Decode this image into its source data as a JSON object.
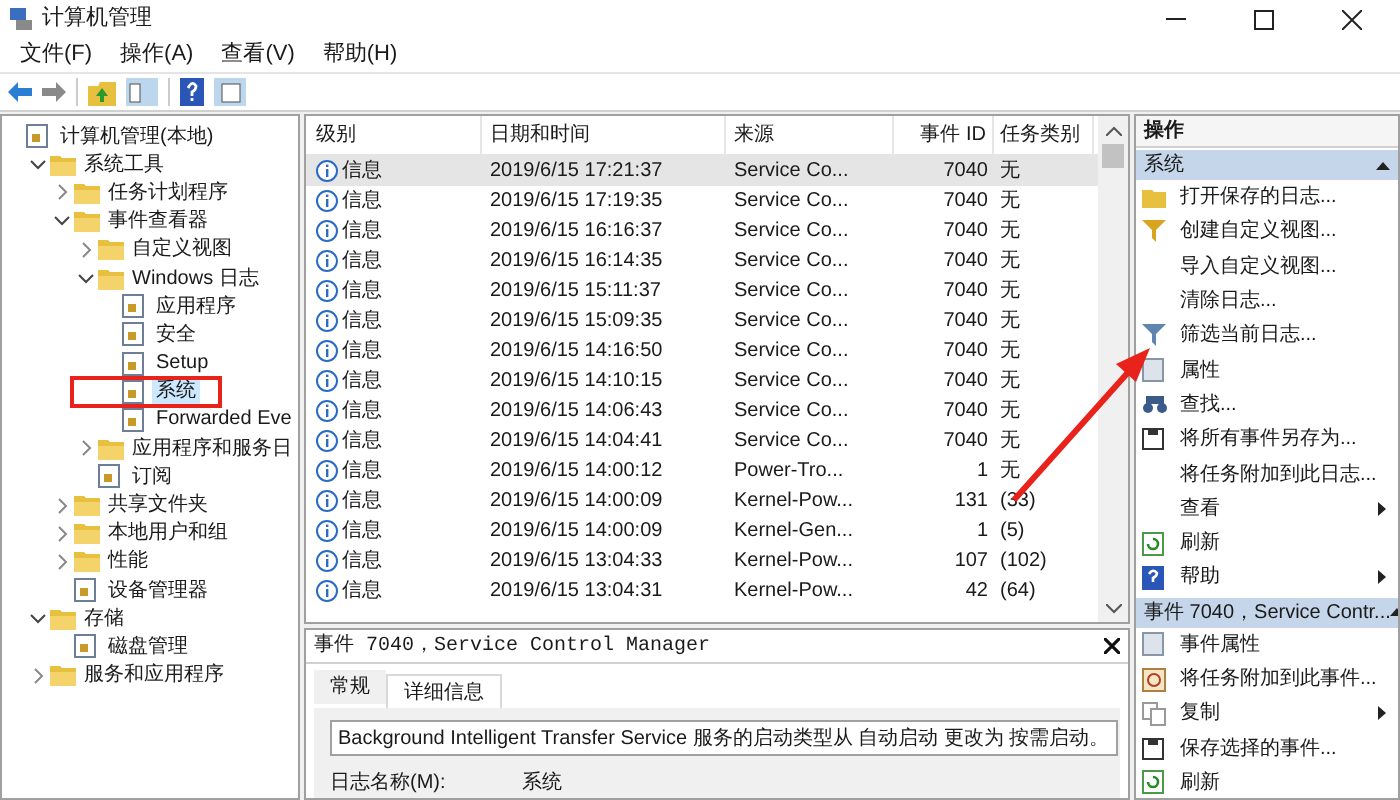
{
  "window": {
    "title": "计算机管理"
  },
  "menu": [
    "文件(F)",
    "操作(A)",
    "查看(V)",
    "帮助(H)"
  ],
  "tree": [
    {
      "label": "计算机管理(本地)",
      "kind": "plain",
      "selected": false,
      "marked": false,
      "children": [
        {
          "label": "系统工具",
          "kind": "toggle",
          "expanded": true,
          "selected": false,
          "marked": false,
          "children": [
            {
              "label": "任务计划程序",
              "kind": "toggle",
              "expanded": false,
              "selected": false,
              "marked": false
            },
            {
              "label": "事件查看器",
              "kind": "toggle",
              "expanded": true,
              "selected": false,
              "marked": false,
              "children": [
                {
                  "label": "自定义视图",
                  "kind": "toggle",
                  "expanded": false,
                  "selected": false,
                  "marked": false
                },
                {
                  "label": "Windows 日志",
                  "kind": "toggle",
                  "expanded": true,
                  "selected": false,
                  "marked": false,
                  "children": [
                    {
                      "label": "应用程序",
                      "kind": "plain",
                      "selected": false,
                      "marked": false
                    },
                    {
                      "label": "安全",
                      "kind": "plain",
                      "selected": false,
                      "marked": false
                    },
                    {
                      "label": "Setup",
                      "kind": "plain",
                      "selected": false,
                      "marked": false
                    },
                    {
                      "label": "系统",
                      "kind": "plain",
                      "selected": true,
                      "marked": true
                    },
                    {
                      "label": "Forwarded Eve",
                      "kind": "plain",
                      "selected": false,
                      "marked": false
                    }
                  ]
                },
                {
                  "label": "应用程序和服务日",
                  "kind": "toggle",
                  "expanded": false,
                  "selected": false,
                  "marked": false
                },
                {
                  "label": "订阅",
                  "kind": "plain",
                  "selected": false,
                  "marked": false
                }
              ]
            },
            {
              "label": "共享文件夹",
              "kind": "toggle",
              "expanded": false,
              "selected": false,
              "marked": false
            },
            {
              "label": "本地用户和组",
              "kind": "toggle",
              "expanded": false,
              "selected": false,
              "marked": false
            },
            {
              "label": "性能",
              "kind": "toggle",
              "expanded": false,
              "selected": false,
              "marked": false
            },
            {
              "label": "设备管理器",
              "kind": "plain",
              "selected": false,
              "marked": false
            }
          ]
        },
        {
          "label": "存储",
          "kind": "toggle",
          "expanded": true,
          "selected": false,
          "marked": false,
          "children": [
            {
              "label": "磁盘管理",
              "kind": "plain",
              "selected": false,
              "marked": false
            }
          ]
        },
        {
          "label": "服务和应用程序",
          "kind": "toggle",
          "expanded": false,
          "selected": false,
          "marked": false
        }
      ]
    }
  ],
  "events": {
    "columns": [
      "级别",
      "日期和时间",
      "来源",
      "事件 ID",
      "任务类别"
    ],
    "rows": [
      {
        "level": "信息",
        "date": "2019/6/15 17:21:37",
        "source": "Service Co...",
        "id": "7040",
        "category": "无",
        "selected": true
      },
      {
        "level": "信息",
        "date": "2019/6/15 17:19:35",
        "source": "Service Co...",
        "id": "7040",
        "category": "无",
        "selected": false
      },
      {
        "level": "信息",
        "date": "2019/6/15 16:16:37",
        "source": "Service Co...",
        "id": "7040",
        "category": "无",
        "selected": false
      },
      {
        "level": "信息",
        "date": "2019/6/15 16:14:35",
        "source": "Service Co...",
        "id": "7040",
        "category": "无",
        "selected": false
      },
      {
        "level": "信息",
        "date": "2019/6/15 15:11:37",
        "source": "Service Co...",
        "id": "7040",
        "category": "无",
        "selected": false
      },
      {
        "level": "信息",
        "date": "2019/6/15 15:09:35",
        "source": "Service Co...",
        "id": "7040",
        "category": "无",
        "selected": false
      },
      {
        "level": "信息",
        "date": "2019/6/15 14:16:50",
        "source": "Service Co...",
        "id": "7040",
        "category": "无",
        "selected": false
      },
      {
        "level": "信息",
        "date": "2019/6/15 14:10:15",
        "source": "Service Co...",
        "id": "7040",
        "category": "无",
        "selected": false
      },
      {
        "level": "信息",
        "date": "2019/6/15 14:06:43",
        "source": "Service Co...",
        "id": "7040",
        "category": "无",
        "selected": false
      },
      {
        "level": "信息",
        "date": "2019/6/15 14:04:41",
        "source": "Service Co...",
        "id": "7040",
        "category": "无",
        "selected": false
      },
      {
        "level": "信息",
        "date": "2019/6/15 14:00:12",
        "source": "Power-Tro...",
        "id": "1",
        "category": "无",
        "selected": false
      },
      {
        "level": "信息",
        "date": "2019/6/15 14:00:09",
        "source": "Kernel-Pow...",
        "id": "131",
        "category": "(33)",
        "selected": false
      },
      {
        "level": "信息",
        "date": "2019/6/15 14:00:09",
        "source": "Kernel-Gen...",
        "id": "1",
        "category": "(5)",
        "selected": false
      },
      {
        "level": "信息",
        "date": "2019/6/15 13:04:33",
        "source": "Kernel-Pow...",
        "id": "107",
        "category": "(102)",
        "selected": false
      },
      {
        "level": "信息",
        "date": "2019/6/15 13:04:31",
        "source": "Kernel-Pow...",
        "id": "42",
        "category": "(64)",
        "selected": false
      }
    ]
  },
  "detail": {
    "title": "事件 7040，Service Control Manager",
    "tabs": [
      {
        "label": "常规",
        "selected": true
      },
      {
        "label": "详细信息",
        "selected": false
      }
    ],
    "message": "Background Intelligent Transfer Service 服务的启动类型从 自动启动 更改为 按需启动。",
    "field_label": "日志名称(M):",
    "field_value": "系统"
  },
  "actions": {
    "title": "操作",
    "sections": [
      {
        "title": "系统",
        "expanded": true,
        "items": [
          {
            "label": "打开保存的日志...",
            "submenu": false
          },
          {
            "label": "创建自定义视图...",
            "submenu": false
          },
          {
            "label": "导入自定义视图...",
            "submenu": false
          },
          {
            "label": "清除日志...",
            "submenu": false
          },
          {
            "label": "筛选当前日志...",
            "submenu": false
          },
          {
            "label": "属性",
            "submenu": false
          },
          {
            "label": "查找...",
            "submenu": false
          },
          {
            "label": "将所有事件另存为...",
            "submenu": false
          },
          {
            "label": "将任务附加到此日志...",
            "submenu": false
          },
          {
            "label": "查看",
            "submenu": true
          },
          {
            "label": "刷新",
            "submenu": false
          },
          {
            "label": "帮助",
            "submenu": true
          }
        ]
      },
      {
        "title": "事件 7040，Service Contr...",
        "expanded": true,
        "items": [
          {
            "label": "事件属性",
            "submenu": false
          },
          {
            "label": "将任务附加到此事件...",
            "submenu": false
          },
          {
            "label": "复制",
            "submenu": true
          },
          {
            "label": "保存选择的事件...",
            "submenu": false
          },
          {
            "label": "刷新",
            "submenu": false
          }
        ]
      }
    ]
  }
}
